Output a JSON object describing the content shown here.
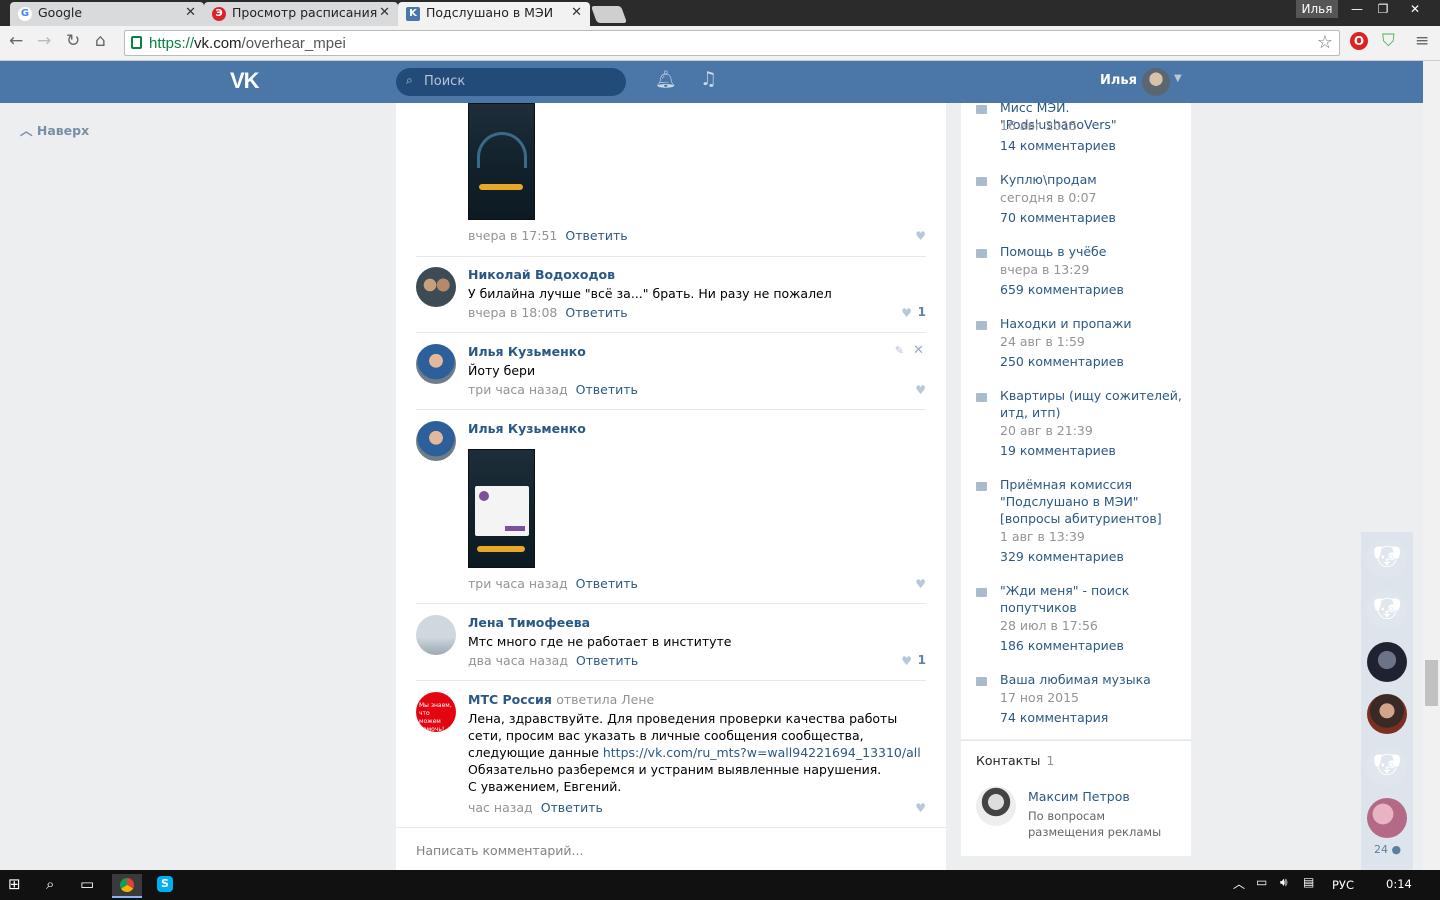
{
  "browser": {
    "tabs": [
      {
        "label": "Google",
        "favicon": "google-icon"
      },
      {
        "label": "Просмотр расписания",
        "favicon": "schedule-icon"
      },
      {
        "label": "Подслушано в МЭИ",
        "favicon": "vk-icon"
      }
    ],
    "profile": "Илья",
    "url_scheme": "https://",
    "url_host": "vk.com",
    "url_path": "/overhear_mpei"
  },
  "vk": {
    "logo": "VK",
    "search_placeholder": "Поиск",
    "user_name": "Илья",
    "back_to_top": "Наверх"
  },
  "comments": [
    {
      "author": "",
      "text": "",
      "time": "вчера в 17:51",
      "reply": "Ответить",
      "likes": ""
    },
    {
      "author": "Николай Водоходов",
      "text": "У билайна лучше \"всё за...\" брать. Ни разу не пожалел",
      "time": "вчера в 18:08",
      "reply": "Ответить",
      "likes": "1"
    },
    {
      "author": "Илья Кузьменко",
      "text": "Йоту бери",
      "time": "три часа назад",
      "reply": "Ответить",
      "likes": ""
    },
    {
      "author": "Илья Кузьменко",
      "text": "",
      "time": "три часа назад",
      "reply": "Ответить",
      "likes": ""
    },
    {
      "author": "Лена Тимофеева",
      "text": "Мтс много где не работает в институте",
      "time": "два часа назад",
      "reply": "Ответить",
      "likes": "1"
    },
    {
      "author": "МТС Россия",
      "replied": "ответила Лене",
      "text_a": "Лена, здравствуйте. Для проведения проверки качества работы сети, просим вас указать в личные сообщения сообщества, следующие данные ",
      "link": "https://vk.com/ru_mts?w=wall94221694_13310/all",
      "text_b": " Обязательно разберемся и устраним выявленные нарушения.",
      "text_c": "С уважением, Евгений.",
      "time": "час назад",
      "reply": "Ответить",
      "likes": "",
      "avatar_text": "Мы знаем, что можем помочь!"
    }
  ],
  "write_placeholder": "Написать комментарий...",
  "topics": [
    {
      "title": "Мисс МЭИ. \"PodslushanoVers\"",
      "date": "16 авг 2015",
      "count": "14 комментариев"
    },
    {
      "title": "Куплю\\продам",
      "date": "сегодня в 0:07",
      "count": "70 комментариев"
    },
    {
      "title": "Помощь в учёбе",
      "date": "вчера в 13:29",
      "count": "659 комментариев"
    },
    {
      "title": "Находки и пропажи",
      "date": "24 авг в 1:59",
      "count": "250 комментариев"
    },
    {
      "title": "Квартиры (ищу сожителей, итд, итп)",
      "date": "20 авг в 21:39",
      "count": "19 комментариев"
    },
    {
      "title": "Приёмная комиссия \"Подслушано в МЭИ\" [вопросы абитуриентов]",
      "date": "1 авг в 13:39",
      "count": "329 комментариев"
    },
    {
      "title": "\"Жди меня\" - поиск попутчиков",
      "date": "28 июл в 17:56",
      "count": "186 комментариев"
    },
    {
      "title": "Ваша любимая музыка",
      "date": "17 ноя 2015",
      "count": "74 комментария"
    }
  ],
  "contacts": {
    "title": "Контакты",
    "count": "1",
    "name": "Максим Петров",
    "role": "По вопросам размещения рекламы"
  },
  "chat_count": "24",
  "taskbar": {
    "lang": "РУС",
    "time": "0:14"
  },
  "colors": {
    "vk_blue": "#4a76a8",
    "link": "#2a5885",
    "background": "#edeef0"
  }
}
